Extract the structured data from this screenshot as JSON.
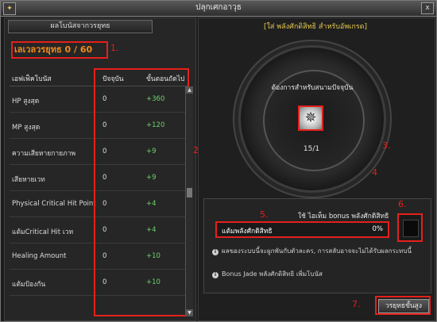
{
  "window": {
    "title": "ปลุกเศกอาวุธ",
    "close_label": "x",
    "icon_label": "✦"
  },
  "left_panel": {
    "tab_label": "ผลโบนัสจากวรยุทธ",
    "level_text": "เลเวลวรยุทธ 0 / 60",
    "columns": {
      "effect": "เอฟเฟ็คโบนัส",
      "current": "ปัจจุบัน",
      "next": "ขั้นตอนถัดไป"
    },
    "rows": [
      {
        "name": "HP สูงสุด",
        "current": "0",
        "next": "+360"
      },
      {
        "name": "MP สูงสุด",
        "current": "0",
        "next": "+120"
      },
      {
        "name": "ความเสียหายกายภาพ",
        "current": "0",
        "next": "+9"
      },
      {
        "name": "เสียหายเวท",
        "current": "0",
        "next": "+9"
      },
      {
        "name": "Physical Critical Hit Point",
        "current": "0",
        "next": "+4"
      },
      {
        "name": "แต้มCritical Hit เวท",
        "current": "0",
        "next": "+4"
      },
      {
        "name": "Healing Amount",
        "current": "0",
        "next": "+10"
      },
      {
        "name": "แต้มป้องกัน",
        "current": "0",
        "next": "+10"
      }
    ]
  },
  "right_panel": {
    "title": "[ใส่ พลังศักดิสิทธิ สำหรับอัพเกรด]",
    "need_label": "ต้องการสำหรับสนามปัจจุบัน",
    "item_count": "15/1",
    "use_label": "ใช้ ไอเท็ม bonus พลังศักดิสิทธิ",
    "progress_label": "แต้มพลังศักดิสิทธิ",
    "progress_percent_text": "0%",
    "progress_value": 0,
    "info_lines": [
      "ผลของระบบนี้จะผูกพันกับตัวละคร, การสลับอาจจะไม่ได้รับผลกระทบนี้",
      "Bonus Jade พลังศักดิสิทธิ เพิ่มโบนัส"
    ],
    "upgrade_button": "วรยุทธขั้นสูง"
  },
  "annotations": [
    "1.",
    "2.",
    "3.",
    "4",
    "5.",
    "6.",
    "7."
  ],
  "colors": {
    "accent_red": "#e5201a",
    "level_orange": "#f08a1a",
    "bonus_green": "#6ed26e",
    "title_gold": "#e6c84f"
  }
}
